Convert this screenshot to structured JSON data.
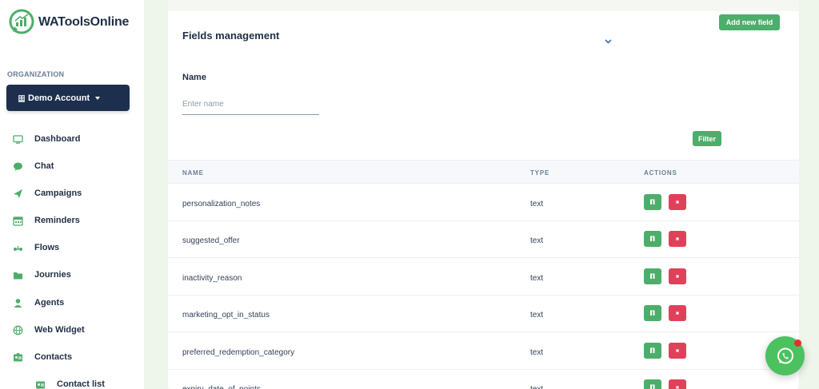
{
  "brand": {
    "name": "WAToolsOnline",
    "accent": "#4cae6a",
    "dark": "#1d2f4d",
    "danger": "#e0415a"
  },
  "sidebar": {
    "org_label": "ORGANIZATION",
    "org_button": "Demo Account",
    "items": [
      {
        "label": "Dashboard",
        "icon": "monitor-icon"
      },
      {
        "label": "Chat",
        "icon": "chat-bubble-icon"
      },
      {
        "label": "Campaigns",
        "icon": "paper-plane-icon"
      },
      {
        "label": "Reminders",
        "icon": "calendar-icon"
      },
      {
        "label": "Flows",
        "icon": "flow-icon"
      },
      {
        "label": "Journies",
        "icon": "folder-icon"
      },
      {
        "label": "Agents",
        "icon": "user-icon"
      },
      {
        "label": "Web Widget",
        "icon": "globe-icon"
      },
      {
        "label": "Contacts",
        "icon": "contact-card-icon"
      }
    ],
    "sub_items": [
      {
        "label": "Contact list",
        "icon": "contact-list-icon"
      }
    ]
  },
  "main": {
    "title": "Fields management",
    "add_button": "Add new field",
    "name_label": "Name",
    "name_placeholder": "Enter name",
    "name_value": "",
    "filter_button": "Filter",
    "table": {
      "headers": {
        "name": "NAME",
        "type": "TYPE",
        "actions": "ACTIONS"
      },
      "rows": [
        {
          "name": "personalization_notes",
          "type": "text"
        },
        {
          "name": "suggested_offer",
          "type": "text"
        },
        {
          "name": "inactivity_reason",
          "type": "text"
        },
        {
          "name": "marketing_opt_in_status",
          "type": "text"
        },
        {
          "name": "preferred_redemption_category",
          "type": "text"
        },
        {
          "name": "expiry_date_of_points",
          "type": "text"
        }
      ]
    }
  }
}
